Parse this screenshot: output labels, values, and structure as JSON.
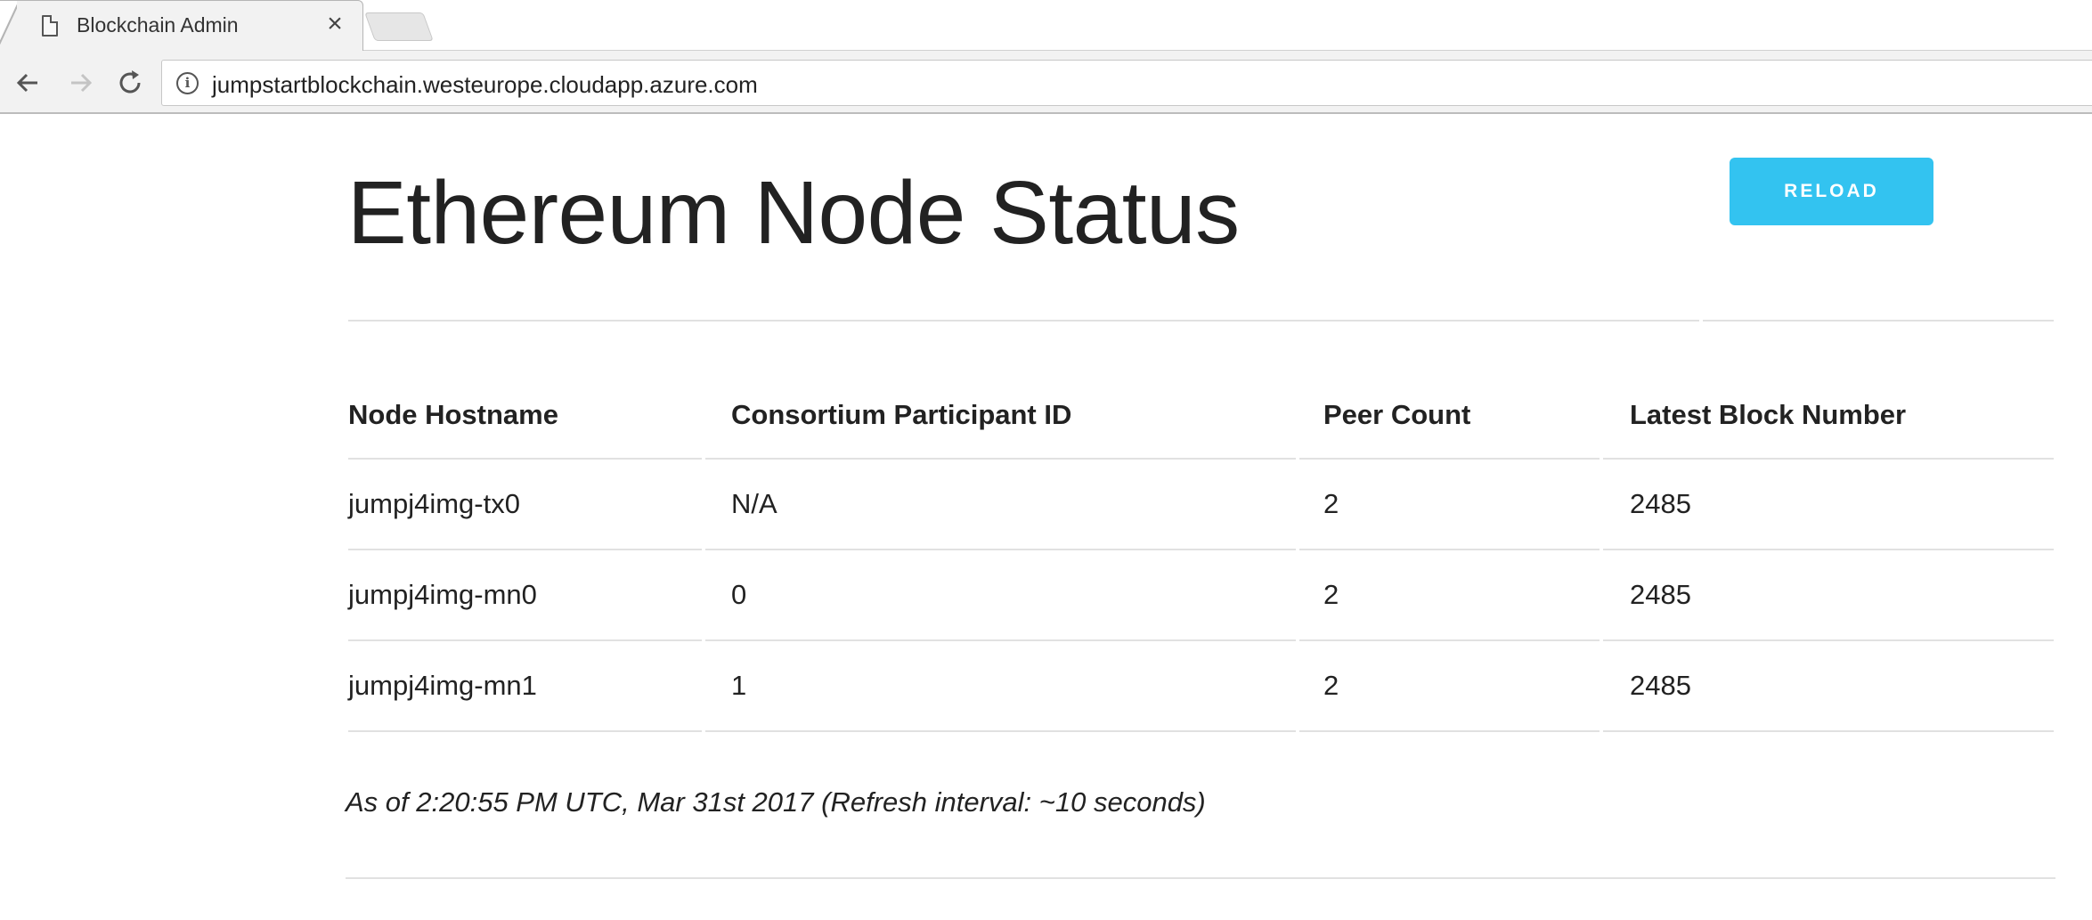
{
  "browser": {
    "tab_title": "Blockchain Admin",
    "tab_close_glyph": "×",
    "url": "jumpstartblockchain.westeurope.cloudapp.azure.com",
    "icons": {
      "tab": "file-icon",
      "close": "close-icon",
      "back": "back-arrow-icon",
      "forward": "forward-arrow-icon",
      "reload": "reload-icon",
      "info": "info-icon"
    }
  },
  "page": {
    "title": "Ethereum Node Status",
    "reload_label": "RELOAD",
    "accent_color": "#33c3f0"
  },
  "table": {
    "headers": [
      "Node Hostname",
      "Consortium Participant ID",
      "Peer Count",
      "Latest Block Number"
    ],
    "rows": [
      [
        "jumpj4img-tx0",
        "N/A",
        "2",
        "2485"
      ],
      [
        "jumpj4img-mn0",
        "0",
        "2",
        "2485"
      ],
      [
        "jumpj4img-mn1",
        "1",
        "2",
        "2485"
      ]
    ]
  },
  "footer": {
    "status_text": "As of 2:20:55 PM UTC, Mar 31st 2017 (Refresh interval: ~10 seconds)"
  }
}
